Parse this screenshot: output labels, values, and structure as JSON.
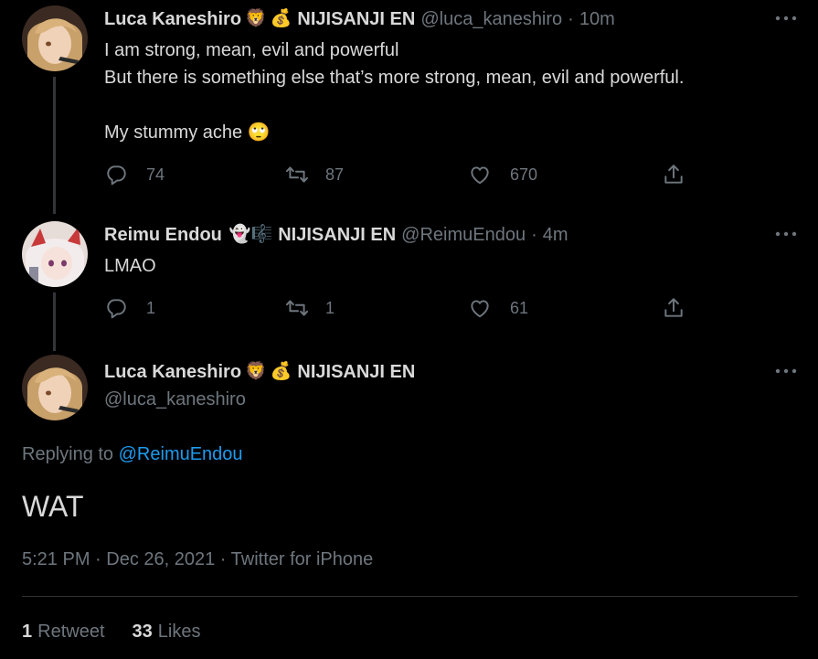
{
  "tweets": [
    {
      "name": "Luca Kaneshiro",
      "emoji1": "🦁",
      "emoji2": "💰",
      "org": "NIJISANJI EN",
      "handle": "@luca_kaneshiro",
      "dot": "·",
      "time": "10m",
      "lines": [
        "I am strong, mean, evil and powerful",
        "But there is something else that’s more strong, mean, evil and powerful.",
        "My stummy ache 🙄"
      ],
      "replies": "74",
      "retweets": "87",
      "likes": "670"
    },
    {
      "name": "Reimu Endou",
      "emoji1": "👻",
      "emoji2": "🎼",
      "org": "NIJISANJI EN",
      "handle": "@ReimuEndou",
      "dot": "·",
      "time": "4m",
      "lines": [
        "LMAO"
      ],
      "replies": "1",
      "retweets": "1",
      "likes": "61"
    }
  ],
  "main_tweet": {
    "name": "Luca Kaneshiro",
    "emoji1": "🦁",
    "emoji2": "💰",
    "org": "NIJISANJI EN",
    "handle": "@luca_kaneshiro",
    "replying_prefix": "Replying to",
    "replying_to": "@ReimuEndou",
    "text": "WAT",
    "meta": "5:21 PM · Dec 26, 2021 · Twitter for iPhone",
    "retweet_count": "1",
    "retweet_label": "Retweet",
    "like_count": "33",
    "like_label": "Likes"
  },
  "icons": {
    "reply": "reply-icon",
    "retweet": "retweet-icon",
    "like": "heart-icon",
    "share": "share-icon",
    "more": "more-icon"
  },
  "colors": {
    "background": "#000000",
    "text": "#d9d9d9",
    "muted": "#6e767d",
    "link": "#1d9bf0",
    "thread_line": "#333639"
  }
}
